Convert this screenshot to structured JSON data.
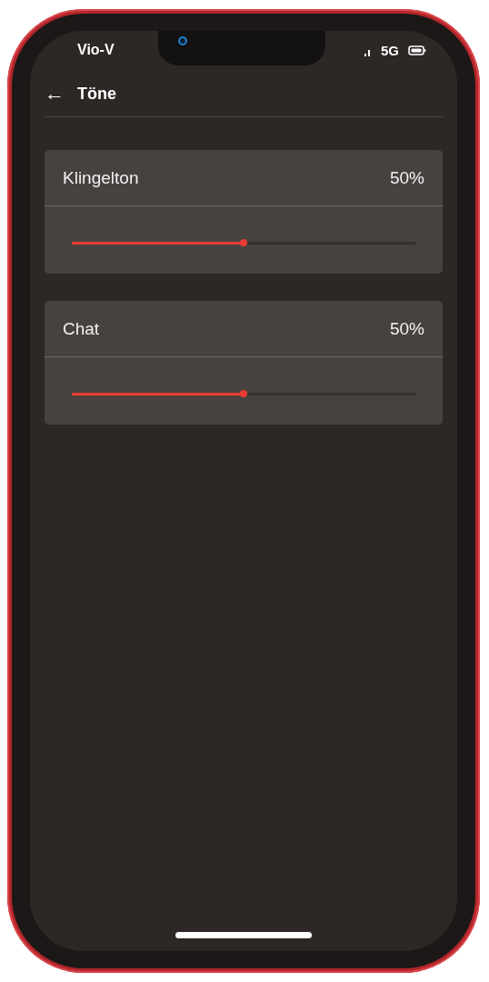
{
  "status_bar": {
    "carrier": "Vio-V",
    "network": "5G"
  },
  "header": {
    "back_icon": "←",
    "title": "Töne"
  },
  "volumes": [
    {
      "name": "Klingelton",
      "reading": "50%",
      "level": 0.5
    },
    {
      "name": "Chat",
      "reading": "50%",
      "level": 0.5
    }
  ]
}
